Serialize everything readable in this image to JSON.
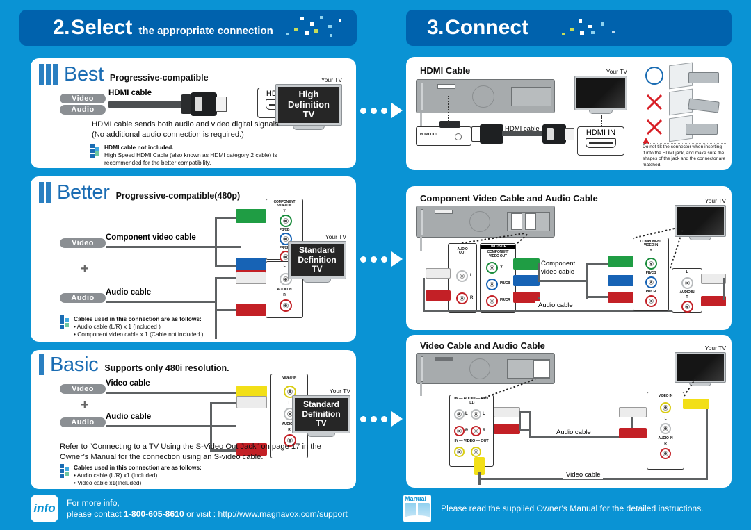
{
  "background_color": "#0a93d4",
  "header_color": "#0062ad",
  "left": {
    "header": {
      "number": "2.",
      "word": "Select",
      "subtitle": "the appropriate connection"
    },
    "sections": [
      {
        "quality": "Best",
        "bars": 3,
        "subtitle": "Progressive-compatible",
        "pills": [
          "Video",
          "Audio"
        ],
        "cable_label": "HDMI cable",
        "jack_label": "HDMI IN",
        "tv_caption": "Your TV",
        "tv_text": [
          "High",
          "Definition",
          "TV"
        ],
        "body": "HDMI cable sends both audio and video digital signals.\n(No additional audio connection is required.)",
        "note_title": "HDMI cable not included.",
        "note_body": "High Speed HDMI Cable (also known as HDMI category 2 cable) is\nrecommended for the better compatibility."
      },
      {
        "quality": "Better",
        "bars": 2,
        "subtitle": "Progressive-compatible(480p)",
        "pills": [
          "Video",
          "Audio"
        ],
        "video_cable_label": "Component video cable",
        "audio_cable_label": "Audio cable",
        "plus": "+",
        "panel_video_title": "COMPONENT\nVIDEO IN",
        "panel_video_jacks": [
          "Y",
          "PB/CB",
          "PR/CR"
        ],
        "panel_audio_title": "AUDIO IN",
        "panel_audio_jacks": [
          "L",
          "R"
        ],
        "tv_caption": "Your TV",
        "tv_text": [
          "Standard",
          "Definition",
          "TV"
        ],
        "note_title": "Cables used in this connection are as follows:",
        "note_items": [
          "• Audio cable (L/R) x 1 (Included )",
          "• Component video cable x 1 (Cable not included.)"
        ]
      },
      {
        "quality": "Basic",
        "bars": 1,
        "subtitle": "Supports only 480i resolution.",
        "pills": [
          "Video",
          "Audio"
        ],
        "video_cable_label": "Video cable",
        "audio_cable_label": "Audio cable",
        "plus": "+",
        "panel_video_title": "VIDEO IN",
        "panel_audio_title": "AUDIO IN",
        "panel_audio_jacks": [
          "L",
          "R"
        ],
        "tv_caption": "Your TV",
        "tv_text": [
          "Standard",
          "Definition",
          "TV"
        ],
        "refer_text": "Refer to “Connecting to a TV Using the S-Video Out Jack“ on page 17 in the\nOwner’s Manual for the connection using an S-video cable.",
        "note_title": "Cables used in this connection are as follows:",
        "note_items": [
          "• Audio cable (L/R) x1 (Included)",
          "• Video cable x1(Included)"
        ]
      }
    ]
  },
  "right": {
    "header": {
      "number": "3.",
      "word": "Connect"
    },
    "sections": [
      {
        "title": "HDMI Cable",
        "device_out_label": "HDMI OUT",
        "cable_label": "HDMI cable",
        "tv_caption": "Your TV",
        "jack_label": "HDMI IN",
        "ok_mark": "circle",
        "bad_marks": [
          "cross",
          "cross"
        ],
        "warning": "Do not tilt the connector when inserting\nit into the HDMI jack, and make sure the\nshapes of the jack and the connector are\nmatched."
      },
      {
        "title": "Component Video Cable and Audio Cable",
        "tv_caption": "Your TV",
        "out_audio_title": "AUDIO\nOUT",
        "out_audio_jacks": [
          "L",
          "R"
        ],
        "out_video_title": "DVD / VCR",
        "out_video_sub": "COMPONENT\nVIDEO OUT",
        "out_video_jacks": [
          "Y",
          "PB/CB",
          "PR/CR"
        ],
        "in_video_title": "COMPONENT\nVIDEO IN",
        "in_video_jacks": [
          "Y",
          "PB/CB",
          "PR/CR"
        ],
        "in_audio_title": "AUDIO IN",
        "in_audio_jacks": [
          "L",
          "R"
        ],
        "cable_label_video": "Component\nvideo cable",
        "cable_label_audio": "Audio cable"
      },
      {
        "title": "Video Cable and Audio Cable",
        "tv_caption": "Your TV",
        "out_audio_title": "IN — AUDIO — OUT",
        "out_audio_sub": "(L1)",
        "out_video_title": "IN — VIDEO — OUT",
        "out_jacks": [
          "L",
          "R"
        ],
        "in_video_title": "VIDEO IN",
        "in_audio_title": "AUDIO IN",
        "in_audio_jacks": [
          "L",
          "R"
        ],
        "cable_label_audio": "Audio cable",
        "cable_label_video": "Video cable"
      }
    ]
  },
  "footer": {
    "info_badge": "info",
    "info_line1": "For more info,",
    "info_line2_pre": "please contact ",
    "info_phone": "1-800-605-8610",
    "info_line2_post": " or visit : http://www.magnavox.com/support",
    "manual_badge": "Manual",
    "manual_text": "Please read the supplied Owner's Manual for the detailed instructions."
  }
}
